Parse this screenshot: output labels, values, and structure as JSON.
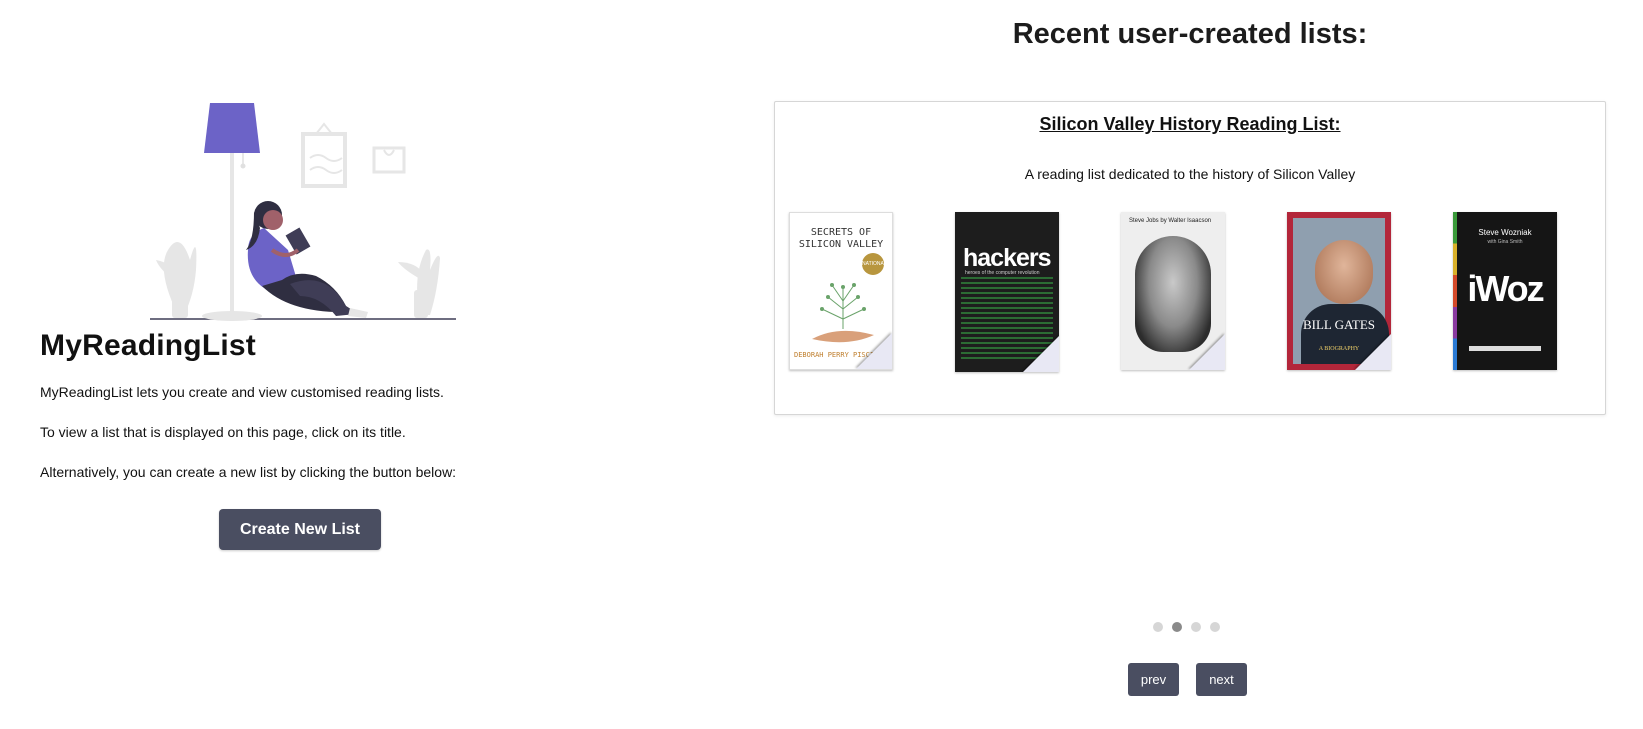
{
  "app": {
    "title": "MyReadingList",
    "intro": "MyReadingList lets you create and view customised reading lists.",
    "view_hint": "To view a list that is displayed on this page, click on its title.",
    "create_hint": "Alternatively, you can create a new list by clicking the button below:",
    "create_button": "Create New List"
  },
  "recent": {
    "heading": "Recent user-created lists:",
    "current_list": {
      "title": "Silicon Valley History Reading List:",
      "description": "A reading list dedicated to the history of Silicon Valley",
      "books": [
        {
          "cover_title": "SECRETS OF SILICON VALLEY",
          "author": "DEBORAH PERRY PISCIONE",
          "badge": "NATIONAL BESTSELLER"
        },
        {
          "cover_title": "hackers",
          "subtitle": "heroes of the computer revolution",
          "author": "steven levy"
        },
        {
          "cover_title": "Steve Jobs by Walter Isaacson"
        },
        {
          "cover_title": "BILL GATES",
          "subtitle": "A BIOGRAPHY"
        },
        {
          "cover_title": "iWoz",
          "author": "Steve Wozniak",
          "with": "with Gina Smith"
        }
      ]
    },
    "carousel": {
      "page_count": 4,
      "active_index": 1,
      "prev_label": "prev",
      "next_label": "next"
    }
  },
  "colors": {
    "button_bg": "#4a4e61",
    "accent_purple": "#6c63c7",
    "dot_inactive": "#d6d6d6",
    "dot_active": "#8a8a8a"
  }
}
